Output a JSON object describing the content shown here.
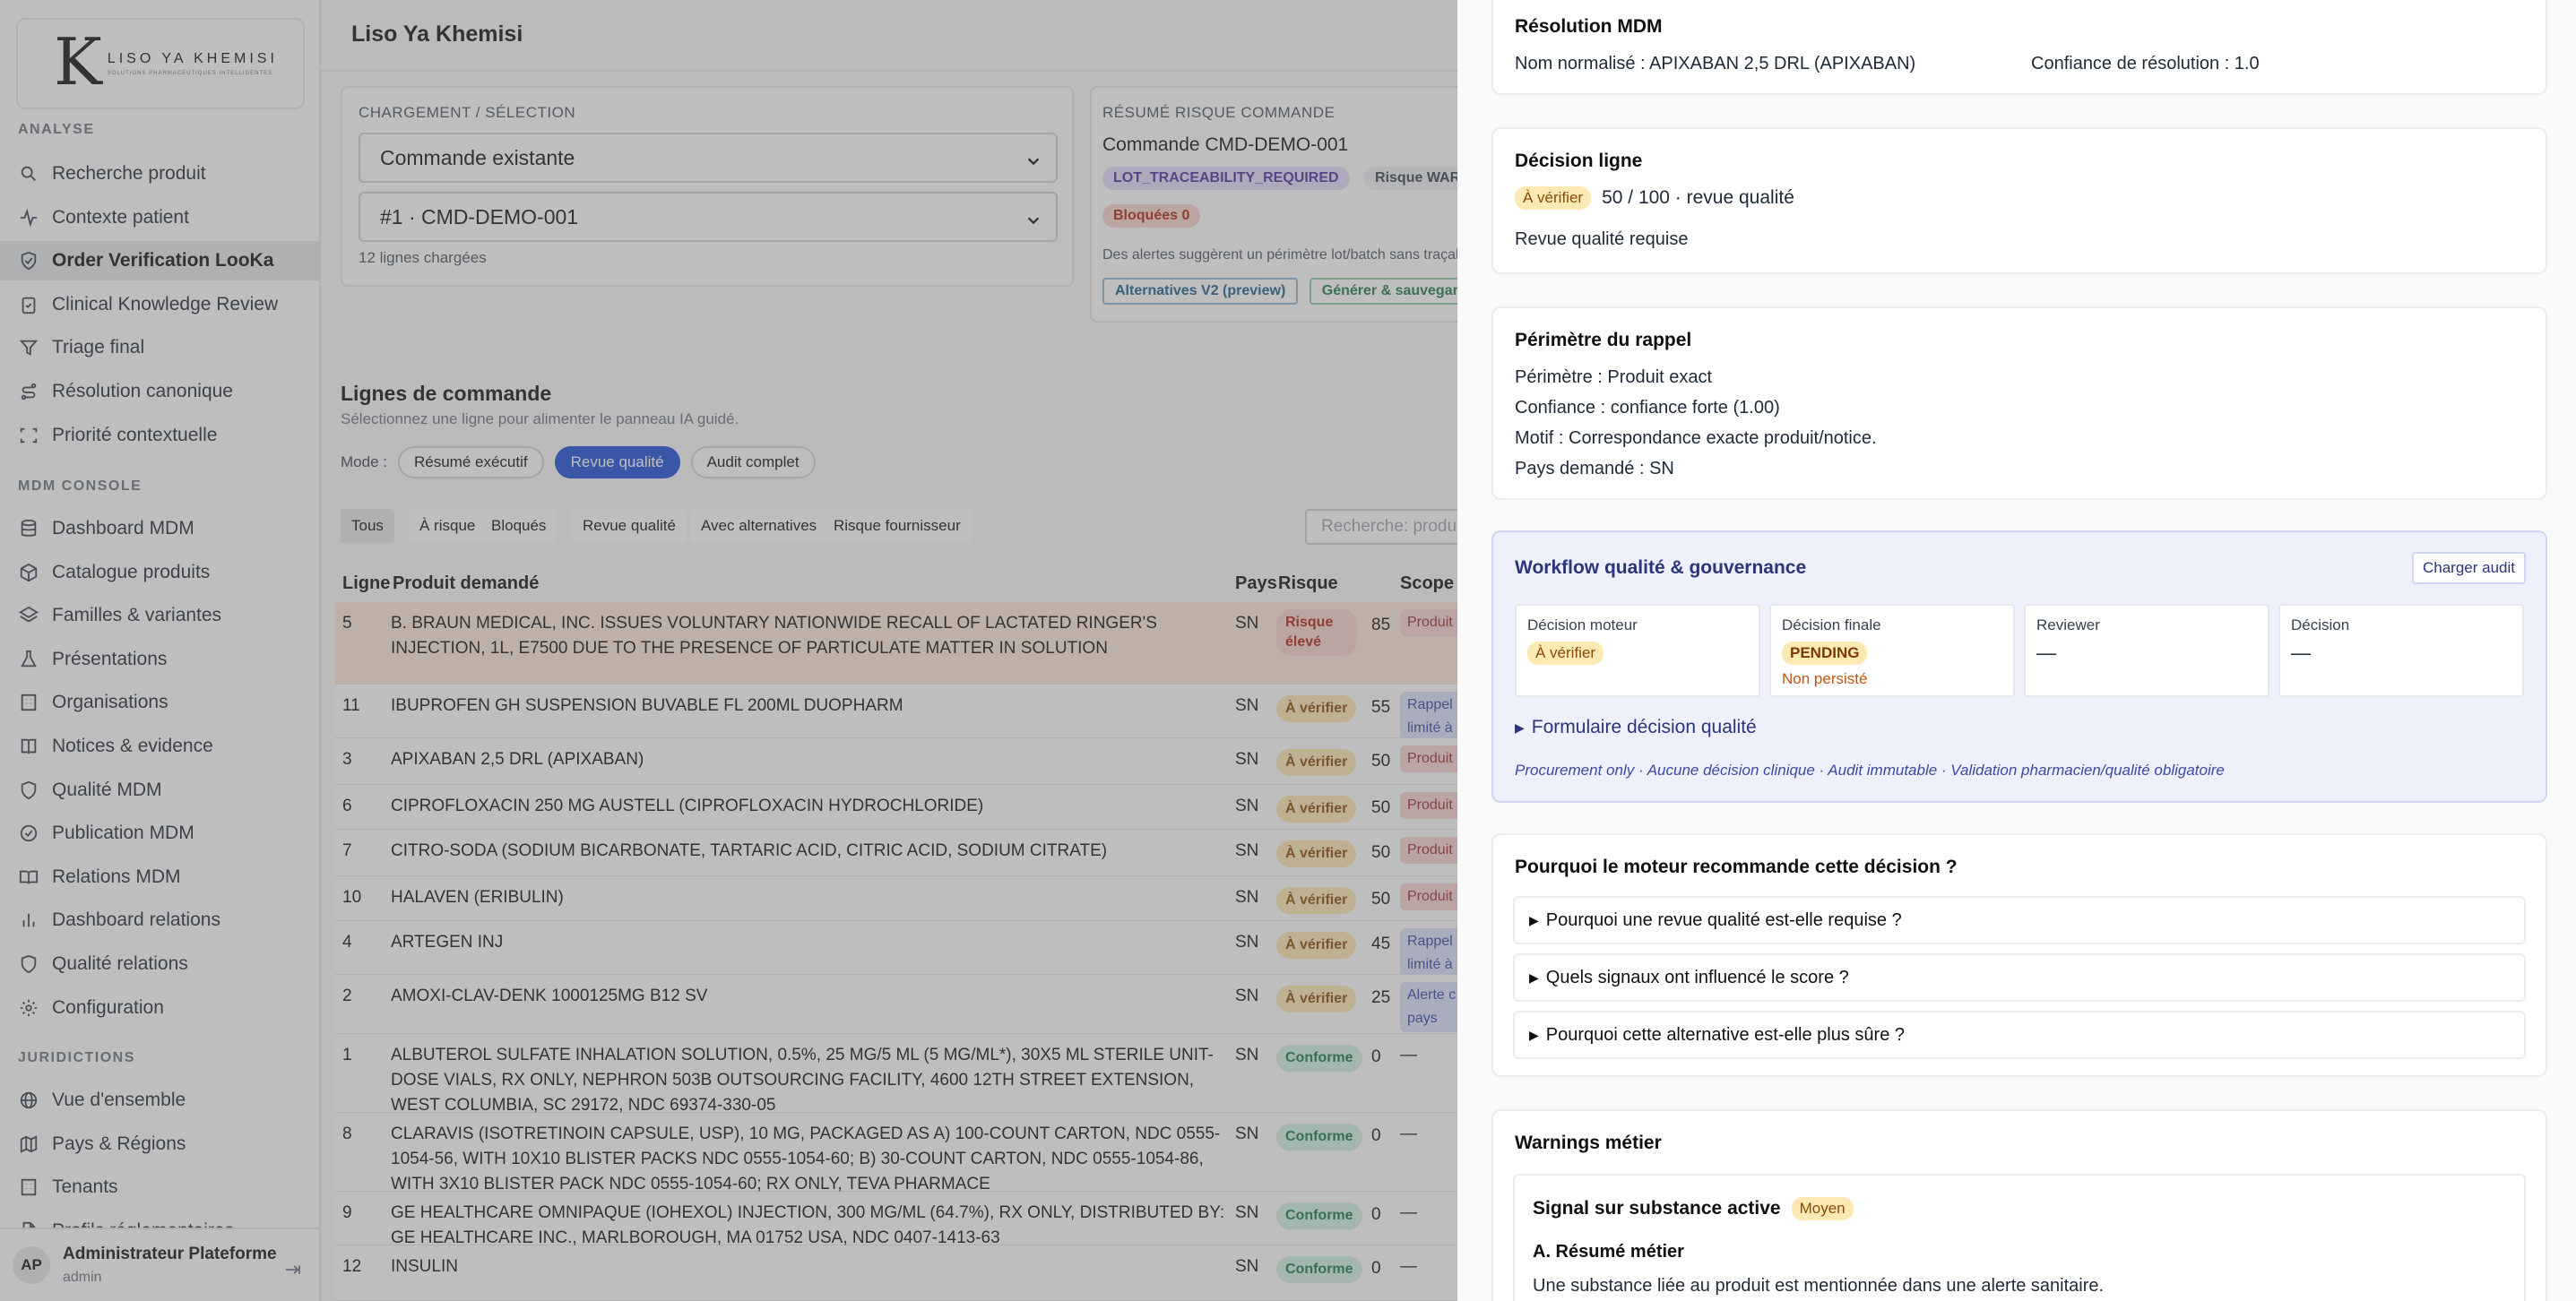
{
  "brand": {
    "mark": "K",
    "name": "LISO YA KHEMISI",
    "tagline": "SOLUTIONS PHARMACEUTIQUES INTELLIGENTES"
  },
  "sidebar": {
    "section_analyse": "ANALYSE",
    "analyse_items": [
      {
        "label": "Recherche produit",
        "icon": "search-icon"
      },
      {
        "label": "Contexte patient",
        "icon": "pulse-icon"
      },
      {
        "label": "Order Verification LooKa",
        "icon": "shield-check-icon"
      },
      {
        "label": "Clinical Knowledge Review",
        "icon": "clipboard-check-icon"
      },
      {
        "label": "Triage final",
        "icon": "filter-icon"
      },
      {
        "label": "Résolution canonique",
        "icon": "route-icon"
      },
      {
        "label": "Priorité contextuelle",
        "icon": "scan-icon"
      }
    ],
    "section_mdm": "MDM CONSOLE",
    "mdm_items": [
      {
        "label": "Dashboard MDM",
        "icon": "database-icon"
      },
      {
        "label": "Catalogue produits",
        "icon": "package-icon"
      },
      {
        "label": "Familles & variantes",
        "icon": "layers-icon"
      },
      {
        "label": "Présentations",
        "icon": "flask-icon"
      },
      {
        "label": "Organisations",
        "icon": "building-icon"
      },
      {
        "label": "Notices & evidence",
        "icon": "book-icon"
      },
      {
        "label": "Qualité MDM",
        "icon": "shield-icon"
      },
      {
        "label": "Publication MDM",
        "icon": "check-circle-icon"
      },
      {
        "label": "Relations MDM",
        "icon": "book-open-icon"
      },
      {
        "label": "Dashboard relations",
        "icon": "bar-chart-icon"
      },
      {
        "label": "Qualité relations",
        "icon": "shield-icon"
      },
      {
        "label": "Configuration",
        "icon": "gear-icon"
      }
    ],
    "section_jur": "JURIDICTIONS",
    "jur_items": [
      {
        "label": "Vue d'ensemble",
        "icon": "globe-icon"
      },
      {
        "label": "Pays & Régions",
        "icon": "map-icon"
      },
      {
        "label": "Tenants",
        "icon": "building-icon"
      },
      {
        "label": "Profils réglementaires",
        "icon": "document-icon"
      }
    ],
    "user": {
      "initials": "AP",
      "name": "Administrateur Plateforme",
      "role": "admin"
    }
  },
  "main": {
    "title": "Liso Ya Khemisi",
    "load": {
      "label": "CHARGEMENT / SÉLECTION",
      "source": "Commande existante",
      "order": "#1 · CMD-DEMO-001",
      "count": "12 lignes chargées"
    },
    "risk": {
      "label": "RÉSUMÉ RISQUE COMMANDE",
      "order": "Commande CMD-DEMO-001",
      "badge_trace": "LOT_TRACEABILITY_REQUIRED",
      "badge_risk": "Risque WARNING",
      "badge_blocked": "Bloquées 0",
      "note": "Des alertes suggèrent un périmètre lot/batch sans traçabilité",
      "btn_alt": "Alternatives V2 (preview)",
      "btn_gen": "Générer & sauvegarder"
    },
    "lines": {
      "title": "Lignes de commande",
      "subtitle": "Sélectionnez une ligne pour alimenter le panneau IA guidé.",
      "mode_label": "Mode :",
      "modes": [
        "Résumé exécutif",
        "Revue qualité",
        "Audit complet"
      ],
      "filters": [
        "Tous",
        "À risque",
        "Bloqués",
        "Revue qualité",
        "Avec alternatives",
        "Risque fournisseur"
      ],
      "search_placeholder": "Recherche: produit, MDM, warning",
      "headers": {
        "ligne": "Ligne",
        "produit": "Produit demandé",
        "pays": "Pays",
        "risque": "Risque",
        "scope": "Scope rappel"
      },
      "rows": [
        {
          "ligne": "5",
          "produit": "B. BRAUN MEDICAL, INC. ISSUES VOLUNTARY NATIONWIDE RECALL OF LACTATED RINGER'S INJECTION, 1L, E7500 DUE TO THE PRESENCE OF PARTICULATE MATTER IN SOLUTION",
          "pays": "SN",
          "risque": "Risque élevé",
          "score": "85",
          "scope": "Produit"
        },
        {
          "ligne": "11",
          "produit": "IBUPROFEN GH SUSPENSION BUVABLE FL 200ML DUOPHARM",
          "pays": "SN",
          "risque": "À vérifier",
          "score": "55",
          "scope": "Rappel limité à ce"
        },
        {
          "ligne": "3",
          "produit": "APIXABAN 2,5 DRL (APIXABAN)",
          "pays": "SN",
          "risque": "À vérifier",
          "score": "50",
          "scope": "Produit"
        },
        {
          "ligne": "6",
          "produit": "CIPROFLOXACIN 250 MG AUSTELL (CIPROFLOXACIN HYDROCHLORIDE)",
          "pays": "SN",
          "risque": "À vérifier",
          "score": "50",
          "scope": "Produit"
        },
        {
          "ligne": "7",
          "produit": "CITRO-SODA (SODIUM BICARBONATE, TARTARIC ACID, CITRIC ACID, SODIUM CITRATE)",
          "pays": "SN",
          "risque": "À vérifier",
          "score": "50",
          "scope": "Produit"
        },
        {
          "ligne": "10",
          "produit": "HALAVEN (ERIBULIN)",
          "pays": "SN",
          "risque": "À vérifier",
          "score": "50",
          "scope": "Produit"
        },
        {
          "ligne": "4",
          "produit": "ARTEGEN INJ",
          "pays": "SN",
          "risque": "À vérifier",
          "score": "45",
          "scope": "Rappel limité à ce"
        },
        {
          "ligne": "2",
          "produit": "AMOXI-CLAV-DENK 1000125MG B12 SV",
          "pays": "SN",
          "risque": "À vérifier",
          "score": "25",
          "scope": "Alerte c pays"
        },
        {
          "ligne": "1",
          "produit": "ALBUTEROL SULFATE INHALATION SOLUTION, 0.5%, 25 MG/5 ML (5 MG/ML*), 30X5 ML STERILE UNIT-DOSE VIALS, RX ONLY, NEPHRON 503B OUTSOURCING FACILITY, 4600 12TH STREET EXTENSION, WEST COLUMBIA, SC 29172, NDC 69374-330-05",
          "pays": "SN",
          "risque": "Conforme",
          "score": "0",
          "scope": "—"
        },
        {
          "ligne": "8",
          "produit": "CLARAVIS (ISOTRETINOIN CAPSULE, USP), 10 MG, PACKAGED AS A) 100-COUNT CARTON, NDC 0555-1054-56, WITH 10X10 BLISTER PACKS NDC 0555-1054-60; B) 30-COUNT CARTON, NDC 0555-1054-86, WITH 3X10 BLISTER PACK NDC 0555-1054-60; RX ONLY, TEVA PHARMACE",
          "pays": "SN",
          "risque": "Conforme",
          "score": "0",
          "scope": "—"
        },
        {
          "ligne": "9",
          "produit": "GE HEALTHCARE OMNIPAQUE (IOHEXOL) INJECTION, 300 MG/ML (64.7%), RX ONLY, DISTRIBUTED BY: GE HEALTHCARE INC., MARLBOROUGH, MA 01752 USA, NDC 0407-1413-63",
          "pays": "SN",
          "risque": "Conforme",
          "score": "0",
          "scope": "—"
        },
        {
          "ligne": "12",
          "produit": "INSULIN",
          "pays": "SN",
          "risque": "Conforme",
          "score": "0",
          "scope": "—"
        }
      ]
    }
  },
  "panel": {
    "mdm": {
      "title": "Résolution MDM",
      "normalized": "Nom normalisé : APIXABAN 2,5 DRL (APIXABAN)",
      "confidence": "Confiance de résolution : 1.0"
    },
    "decision": {
      "title": "Décision ligne",
      "badge": "À vérifier",
      "score": "50 / 100 · revue qualité",
      "note": "Revue qualité requise"
    },
    "recall": {
      "title": "Périmètre du rappel",
      "lines": [
        "Périmètre : Produit exact",
        "Confiance : confiance forte (1.00)",
        "Motif : Correspondance exacte produit/notice.",
        "Pays demandé : SN"
      ]
    },
    "workflow": {
      "title": "Workflow qualité & gouvernance",
      "button": "Charger audit",
      "boxes": [
        {
          "label": "Décision moteur",
          "value": "À vérifier"
        },
        {
          "label": "Décision finale",
          "value": "PENDING",
          "sub": "Non persisté"
        },
        {
          "label": "Reviewer",
          "value": "—"
        },
        {
          "label": "Décision",
          "value": "—"
        }
      ],
      "form": "Formulaire décision qualité",
      "note": "Procurement only · Aucune décision clinique · Audit immutable · Validation pharmacien/qualité obligatoire"
    },
    "why": {
      "title": "Pourquoi le moteur recommande cette décision ?",
      "items": [
        "Pourquoi une revue qualité est-elle requise ?",
        "Quels signaux ont influencé le score ?",
        "Pourquoi cette alternative est-elle plus sûre ?"
      ]
    },
    "warnings": {
      "title": "Warnings métier",
      "signal": "Signal sur substance active",
      "level": "Moyen",
      "section": "A. Résumé métier",
      "text": "Une substance liée au produit est mentionnée dans une alerte sanitaire."
    }
  }
}
